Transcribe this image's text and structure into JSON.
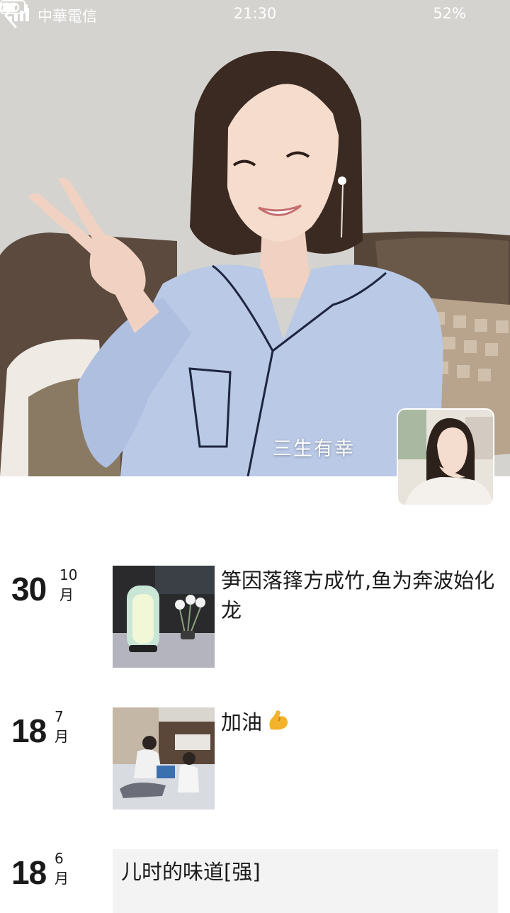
{
  "status_bar": {
    "carrier": "中華電信",
    "time": "21:30",
    "battery": "52%",
    "icons": [
      "signal-icon",
      "link-icon",
      "battery-icon"
    ]
  },
  "header": {
    "back_icon": "chevron-left-icon",
    "cover_name": "三生有幸"
  },
  "posts": [
    {
      "day": "30",
      "month": "10月",
      "text": "笋因落箨方成竹,鱼为奔波始化龙",
      "media": "photo"
    },
    {
      "day": "18",
      "month": "7月",
      "text": "加油",
      "emoji": "flexed-biceps-icon",
      "media": "photo"
    },
    {
      "day": "18",
      "month": "6月",
      "text": "儿时的味道[强]",
      "media": "text-only"
    }
  ],
  "colors": {
    "text": "#1a1a1a",
    "card_bg": "#f3f3f3",
    "overlay_text": "#ffffff"
  }
}
